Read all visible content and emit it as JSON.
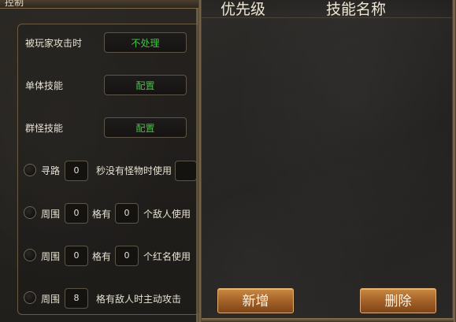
{
  "left": {
    "title_fragment": "控制",
    "rows": [
      {
        "label": "被玩家攻击时",
        "button": "不处理"
      },
      {
        "label": "单体技能",
        "button": "配置"
      },
      {
        "label": "群怪技能",
        "button": "配置"
      }
    ],
    "pathfind": {
      "label": "寻路",
      "value": "0",
      "suffix": "秒没有怪物时使用"
    },
    "around_enemies": {
      "prefix": "周围",
      "value1": "0",
      "mid": "格有",
      "value2": "0",
      "suffix": "个敌人使用"
    },
    "around_rednames": {
      "prefix": "周围",
      "value1": "0",
      "mid": "格有",
      "value2": "0",
      "suffix": "个红名使用"
    },
    "auto_attack": {
      "prefix": "周围",
      "value": "8",
      "suffix": "格有敌人时主动攻击"
    }
  },
  "right": {
    "headers": [
      "优先级",
      "技能名称"
    ],
    "add_button": "新增",
    "delete_button": "删除"
  },
  "colors": {
    "accent_green": "#3fc63f",
    "button_gold": "#b06a2c",
    "frame": "#8a7552"
  }
}
